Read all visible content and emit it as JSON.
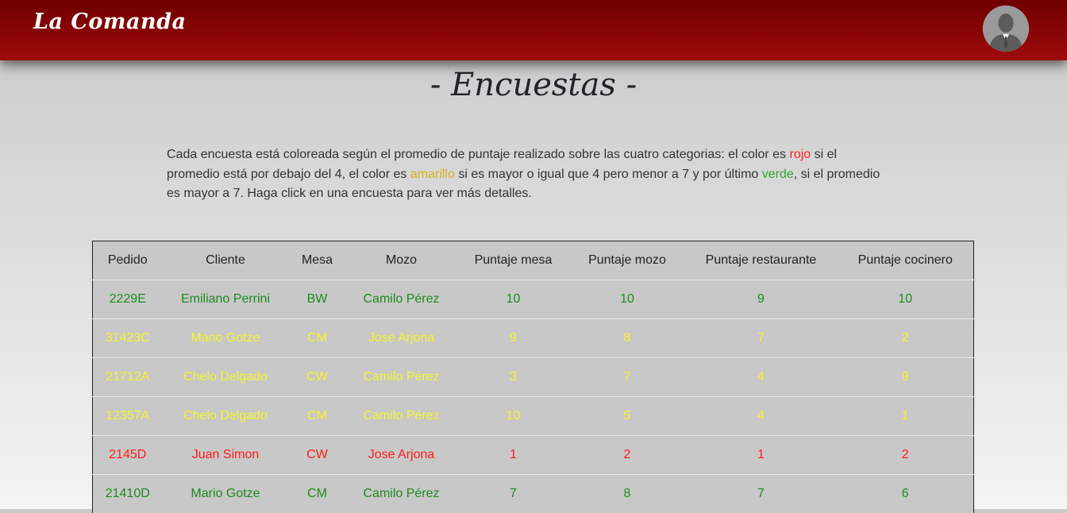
{
  "header": {
    "brand": "La Comanda",
    "avatar_icon": "user-avatar-icon"
  },
  "page": {
    "title": "- Encuestas -"
  },
  "description": {
    "part1": "Cada encuesta está coloreada según el promedio de puntaje realizado sobre las cuatro categorias: el color es ",
    "red_word": "rojo",
    "part2": " si el promedio está por debajo del 4, el color es ",
    "yellow_word": "amarillo",
    "part3": " si es mayor o igual que 4 pero menor a 7 y por último ",
    "green_word": "verde",
    "part4": ", si el promedio es mayor a 7. Haga click en una encuesta para ver más detalles."
  },
  "colors": {
    "navbar": "#a00a0a",
    "red": "#ff1a1a",
    "yellow": "#f5f52a",
    "green": "#1e8a1e"
  },
  "table": {
    "headers": [
      "Pedido",
      "Cliente",
      "Mesa",
      "Mozo",
      "Puntaje mesa",
      "Puntaje mozo",
      "Puntaje restaurante",
      "Puntaje cocinero"
    ],
    "rows": [
      {
        "status": "green",
        "cells": [
          "2229E",
          "Emiliano Perrini",
          "BW",
          "Camilo Pérez",
          "10",
          "10",
          "9",
          "10"
        ]
      },
      {
        "status": "yellow",
        "cells": [
          "31423C",
          "Mario Gotze",
          "CM",
          "Jose Arjona",
          "9",
          "8",
          "7",
          "2"
        ]
      },
      {
        "status": "yellow",
        "cells": [
          "21712A",
          "Chelo Delgado",
          "CW",
          "Camilo Pérez",
          "3",
          "7",
          "4",
          "9"
        ]
      },
      {
        "status": "yellow",
        "cells": [
          "12357A",
          "Chelo Delgado",
          "CM",
          "Camilo Pérez",
          "10",
          "5",
          "4",
          "1"
        ]
      },
      {
        "status": "red",
        "cells": [
          "2145D",
          "Juan Simon",
          "CW",
          "Jose Arjona",
          "1",
          "2",
          "1",
          "2"
        ]
      },
      {
        "status": "green",
        "cells": [
          "21410D",
          "Mario Gotze",
          "CM",
          "Camilo Pérez",
          "7",
          "8",
          "7",
          "6"
        ]
      }
    ]
  }
}
